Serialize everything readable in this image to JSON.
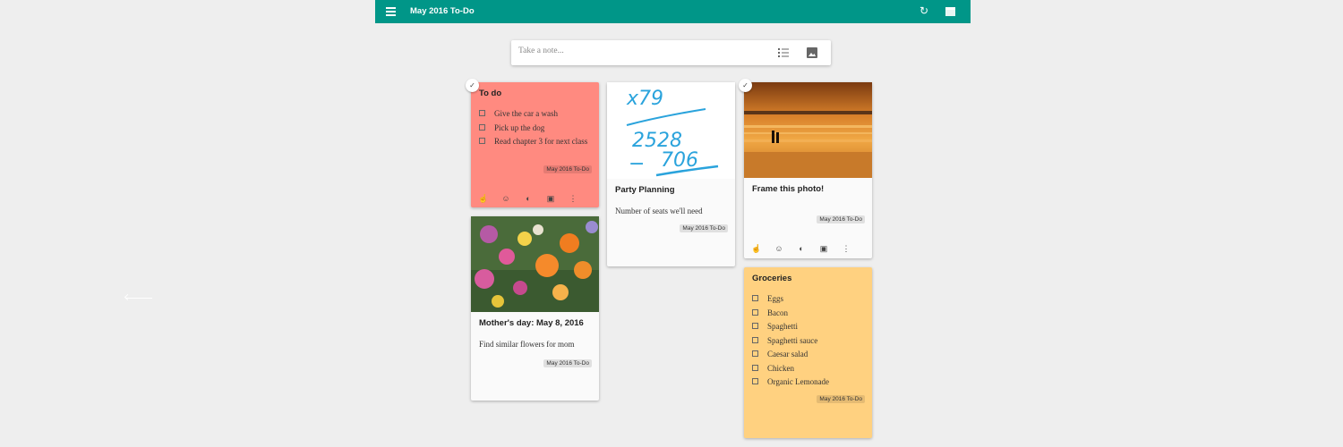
{
  "app": {
    "title": "May 2016 To-Do",
    "accent": "#009688"
  },
  "take_note": {
    "placeholder": "Take a note..."
  },
  "cards": {
    "todo": {
      "title": "To do",
      "items": [
        "Give the car a wash",
        "Pick up the dog",
        "Read chapter 3 for next class"
      ],
      "label": "May 2016 To-Do",
      "color": "#ff8a80"
    },
    "mothers_day": {
      "title": "Mother's day: May 8, 2016",
      "body": "Find similar flowers for mom",
      "label": "May 2016 To-Do"
    },
    "party": {
      "title": "Party Planning",
      "body": "Number of seats we'll need",
      "label": "May 2016 To-Do",
      "drawing_text": [
        "x79",
        "2528",
        "706"
      ]
    },
    "frame": {
      "title": "Frame this photo!",
      "label": "May 2016 To-Do"
    },
    "groceries": {
      "title": "Groceries",
      "items": [
        "Eggs",
        "Bacon",
        "Spaghetti",
        "Spaghetti sauce",
        "Caesar salad",
        "Chicken",
        "Organic Lemonade"
      ],
      "label": "May 2016 To-Do",
      "color": "#ffd180"
    }
  },
  "icons": [
    "menu-icon",
    "refresh-icon",
    "view-toggle-icon",
    "list-icon",
    "image-icon",
    "reminder-icon",
    "collaborator-icon",
    "palette-icon",
    "archive-icon",
    "more-icon",
    "check-icon"
  ]
}
